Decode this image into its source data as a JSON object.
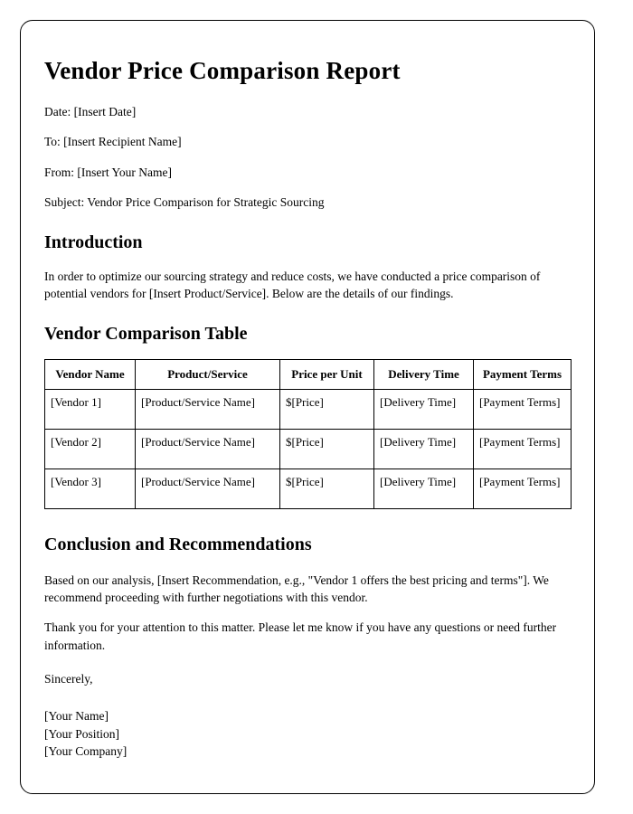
{
  "document": {
    "title": "Vendor Price Comparison Report",
    "meta": {
      "date": "Date: [Insert Date]",
      "to": "To: [Insert Recipient Name]",
      "from": "From: [Insert Your Name]",
      "subject": "Subject: Vendor Price Comparison for Strategic Sourcing"
    },
    "introduction": {
      "heading": "Introduction",
      "paragraph": "In order to optimize our sourcing strategy and reduce costs, we have conducted a price comparison of potential vendors for [Insert Product/Service]. Below are the details of our findings."
    },
    "table_section": {
      "heading": "Vendor Comparison Table",
      "columns": [
        "Vendor Name",
        "Product/Service",
        "Price per Unit",
        "Delivery Time",
        "Payment Terms"
      ],
      "rows": [
        {
          "vendor": "[Vendor 1]",
          "product": "[Product/Service Name]",
          "price": "$[Price]",
          "delivery": "[Delivery Time]",
          "payment": "[Payment Terms]"
        },
        {
          "vendor": "[Vendor 2]",
          "product": "[Product/Service Name]",
          "price": "$[Price]",
          "delivery": "[Delivery Time]",
          "payment": "[Payment Terms]"
        },
        {
          "vendor": "[Vendor 3]",
          "product": "[Product/Service Name]",
          "price": "$[Price]",
          "delivery": "[Delivery Time]",
          "payment": "[Payment Terms]"
        }
      ]
    },
    "conclusion": {
      "heading": "Conclusion and Recommendations",
      "paragraph_1": "Based on our analysis, [Insert Recommendation, e.g., \"Vendor 1 offers the best pricing and terms\"]. We recommend proceeding with further negotiations with this vendor.",
      "paragraph_2": "Thank you for your attention to this matter. Please let me know if you have any questions or need further information."
    },
    "signature": {
      "sincerely": "Sincerely,",
      "name": "[Your Name]",
      "position": "[Your Position]",
      "company": "[Your Company]"
    }
  }
}
